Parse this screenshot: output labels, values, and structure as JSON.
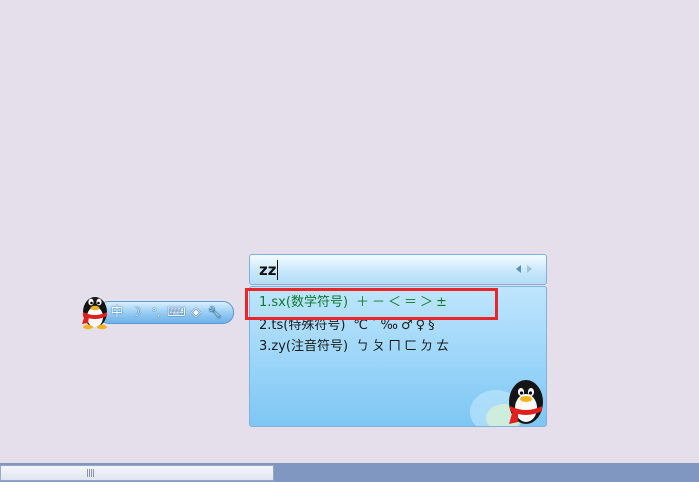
{
  "composition": {
    "text": "zz",
    "prev_page_icon": "triangle-left-icon",
    "next_page_icon": "triangle-right-icon"
  },
  "candidates": [
    {
      "code": "1.sx(数学符号)",
      "symbols": "＋－＜＝＞±",
      "selected": true
    },
    {
      "code": "2.ts(特殊符号)",
      "symbols": "℃ˊ‰♂♀§",
      "selected": false
    },
    {
      "code": "3.zy(注音符号)",
      "symbols": "ㄅㄆㄇㄈㄉㄊ",
      "selected": false
    }
  ],
  "status_bar": {
    "mascot_icon": "qq-penguin-icon",
    "buttons": [
      {
        "name": "chinese-mode-button",
        "glyph": "中",
        "icon": "chinese-mode-icon"
      },
      {
        "name": "half-width-button",
        "glyph": "☽",
        "icon": "moon-icon"
      },
      {
        "name": "punctuation-button",
        "glyph": "°,",
        "icon": "punctuation-icon"
      },
      {
        "name": "soft-keyboard-button",
        "glyph": "⌨",
        "icon": "keyboard-icon"
      },
      {
        "name": "skin-button",
        "glyph": "◈",
        "icon": "skin-icon"
      },
      {
        "name": "settings-button",
        "glyph": "🔧",
        "icon": "wrench-icon"
      }
    ]
  },
  "colors": {
    "highlight_border": "#e8262a",
    "selected_candidate_text": "#0d7a2a",
    "panel_blue": "#9ad5f9"
  }
}
